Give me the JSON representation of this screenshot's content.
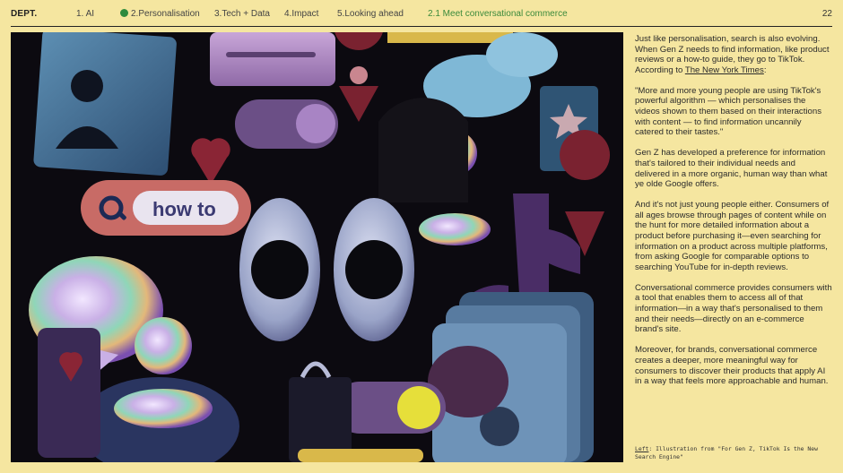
{
  "header": {
    "logo": "DEPT.",
    "nav": [
      {
        "label": "1. AI"
      },
      {
        "label": "2.Personalisation"
      },
      {
        "label": "3.Tech + Data"
      },
      {
        "label": "4.Impact"
      },
      {
        "label": "5.Looking ahead"
      },
      {
        "label": "2.1 Meet conversational commerce"
      }
    ],
    "page_number": "22"
  },
  "illustration": {
    "search_text": "how to"
  },
  "article": {
    "p1_text": "Just like personalisation, search is also evolving. When Gen Z needs to find information, like product reviews or a how-to guide, they go to TikTok. According to ",
    "p1_link": "The New York Times",
    "p1_end": ":",
    "p2": "\"More and more young people are using TikTok's powerful algorithm — which personalises the videos shown to them based on their interactions with content — to find information uncannily catered to their tastes.\"",
    "p3": "Gen Z has developed a preference for information that's tailored to their individual needs and delivered in a more organic, human way than what ye olde Google offers.",
    "p4": "And it's not just young people either. Consumers of all ages browse through pages of content while on the hunt for more detailed information about a product before purchasing it—even searching for information on a product across multiple platforms, from asking Google for comparable options to searching YouTube for in-depth reviews.",
    "p5": "Conversational commerce provides consumers with a tool that enables them to access all of that information—in a way that's personalised to them and their needs—directly on an e-commerce brand's site.",
    "p6": "Moreover, for brands, conversational commerce creates a deeper, more meaningful way for consumers to discover their products that apply AI in a way that feels more approachable and human."
  },
  "caption": {
    "lead": "Left",
    "text": ": Illustration from \"For Gen Z, TikTok Is the New Search Engine\""
  },
  "colors": {
    "background": "#f5e6a0",
    "accent_green": "#3b8a3b",
    "illustration_bg": "#0c0a10"
  }
}
